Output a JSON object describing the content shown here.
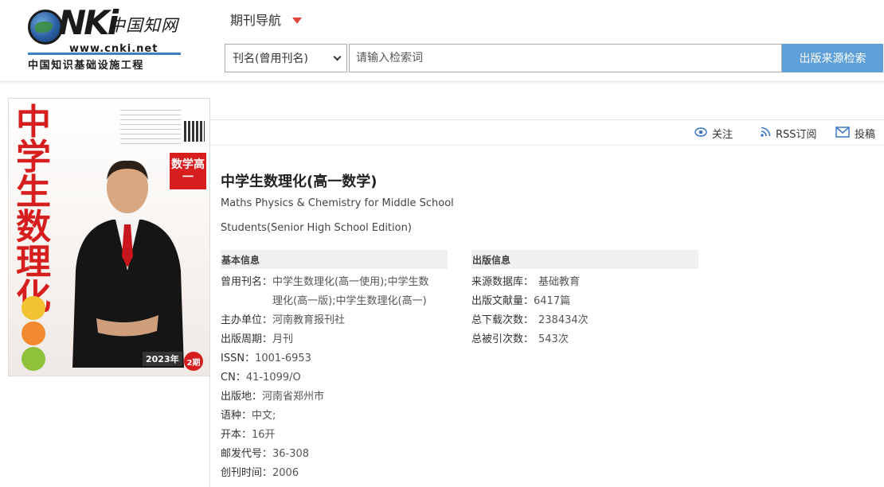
{
  "logo": {
    "brand": "CNKI",
    "cn_name": "中国知网",
    "url": "www.cnki.net",
    "subtitle": "中国知识基础设施工程"
  },
  "nav": {
    "title": "期刊导航"
  },
  "search": {
    "select_value": "刊名(曾用刊名)",
    "placeholder": "请输入检索词",
    "button_label": "出版来源检索"
  },
  "actions": {
    "follow": "关注",
    "rss": "RSS订阅",
    "submit": "投稿"
  },
  "cover": {
    "title_chars": [
      "中",
      "学",
      "生",
      "数",
      "理",
      "化"
    ],
    "badge": "数学高一",
    "year": "2023年",
    "issue": "2期"
  },
  "journal": {
    "title": "中学生数理化(高一数学)",
    "english_line1": "Maths Physics & Chemistry for Middle School",
    "english_line2": "Students(Senior High School Edition)"
  },
  "basic_info": {
    "heading": "基本信息",
    "rows": [
      {
        "key": "曾用刊名：",
        "value": "中学生数理化(高一使用);中学生数",
        "value2": "理化(高一版);中学生数理化(高一)"
      },
      {
        "key": "主办单位：",
        "value": "河南教育报刊社"
      },
      {
        "key": "出版周期：",
        "value": "月刊"
      },
      {
        "key": "ISSN：",
        "value": "1001-6953"
      },
      {
        "key": "CN：",
        "value": "41-1099/O"
      },
      {
        "key": "出版地：",
        "value": "河南省郑州市"
      },
      {
        "key": "语种：",
        "value": "中文;"
      },
      {
        "key": "开本：",
        "value": "16开"
      },
      {
        "key": "邮发代号：",
        "value": "36-308"
      },
      {
        "key": "创刊时间：",
        "value": "2006"
      }
    ]
  },
  "pub_info": {
    "heading": "出版信息",
    "rows": [
      {
        "key": "来源数据库：",
        "value": "基础教育"
      },
      {
        "key": "出版文献量：",
        "value": "6417篇"
      },
      {
        "key": "总下载次数：",
        "value": "238434次"
      },
      {
        "key": "总被引次数：",
        "value": "543次"
      }
    ]
  },
  "colors": {
    "accent_blue": "#5e9fd8",
    "nav_arrow": "#e0463b",
    "cover_red": "#d71e1e"
  }
}
